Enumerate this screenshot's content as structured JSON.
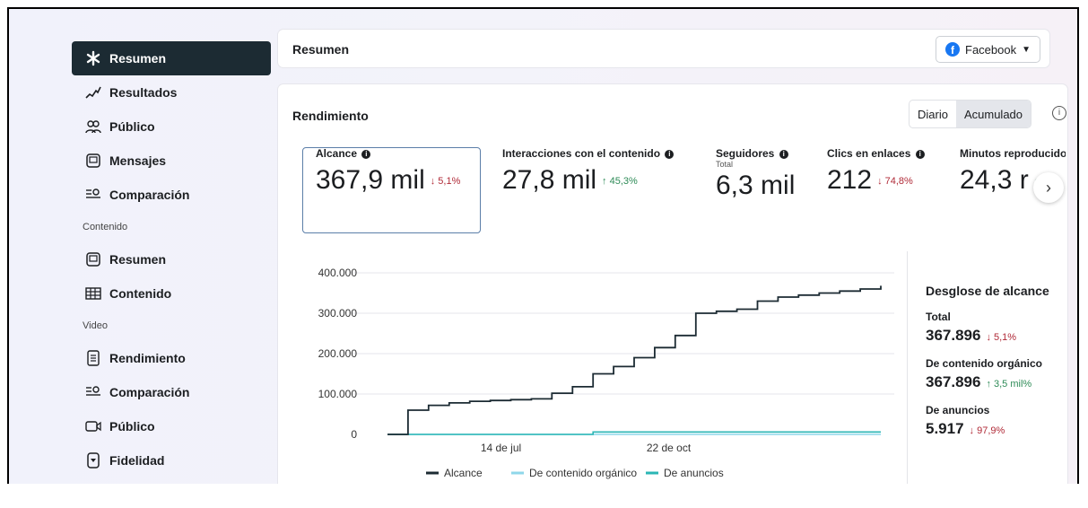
{
  "sidebar": {
    "items": [
      {
        "label": "Resumen",
        "icon": "asterisk-icon",
        "active": true
      },
      {
        "label": "Resultados",
        "icon": "trend-icon"
      },
      {
        "label": "Público",
        "icon": "people-icon"
      },
      {
        "label": "Mensajes",
        "icon": "inbox-icon"
      },
      {
        "label": "Comparación",
        "icon": "compare-icon"
      }
    ],
    "section_content": "Contenido",
    "content_items": [
      {
        "label": "Resumen",
        "icon": "inbox-icon"
      },
      {
        "label": "Contenido",
        "icon": "table-icon"
      }
    ],
    "section_video": "Video",
    "video_items": [
      {
        "label": "Rendimiento",
        "icon": "doc-icon"
      },
      {
        "label": "Comparación",
        "icon": "compare-icon"
      },
      {
        "label": "Público",
        "icon": "video-icon"
      },
      {
        "label": "Fidelidad",
        "icon": "shield-icon"
      }
    ]
  },
  "header": {
    "title": "Resumen",
    "platform": "Facebook"
  },
  "main": {
    "title": "Rendimiento",
    "toggle": [
      "Diario",
      "Acumulado"
    ],
    "metrics": [
      {
        "label": "Alcance",
        "value": "367,9 mil",
        "delta": "↓ 5,1%",
        "dir": "down"
      },
      {
        "label": "Interacciones con el contenido",
        "value": "27,8 mil",
        "delta": "↑ 45,3%",
        "dir": "up"
      },
      {
        "label": "Seguidores",
        "sub": "Total",
        "value": "6,3 mil"
      },
      {
        "label": "Clics en enlaces",
        "value": "212",
        "delta": "↓ 74,8%",
        "dir": "down"
      },
      {
        "label": "Minutos reproducido",
        "value": "24,3 r",
        "delta": "↑",
        "dir": "up"
      }
    ]
  },
  "breakdown": {
    "title": "Desglose de alcance",
    "rows": [
      {
        "label": "Total",
        "value": "367.896",
        "delta": "↓ 5,1%",
        "dir": "down"
      },
      {
        "label": "De contenido orgánico",
        "value": "367.896",
        "delta": "↑ 3,5 mil%",
        "dir": "up"
      },
      {
        "label": "De anuncios",
        "value": "5.917",
        "delta": "↓ 97,9%",
        "dir": "down"
      }
    ]
  },
  "chart_data": {
    "type": "line",
    "y_ticks": [
      "400.000",
      "300.000",
      "200.000",
      "100.000",
      "0"
    ],
    "ylim": [
      0,
      400000
    ],
    "x_tick_labels": [
      "14 de jul",
      "22 de oct"
    ],
    "colors": {
      "Alcance": "#1c2b33",
      "De contenido orgánico": "#8fd7ea",
      "De anuncios": "#2bb6b5"
    },
    "series": [
      {
        "name": "Alcance",
        "values": [
          0,
          60000,
          72000,
          78000,
          82000,
          84000,
          86000,
          88000,
          102000,
          118000,
          150000,
          168000,
          190000,
          215000,
          245000,
          300000,
          305000,
          310000,
          330000,
          340000,
          345000,
          350000,
          355000,
          360000,
          367896
        ]
      },
      {
        "name": "De contenido orgánico",
        "values": [
          0,
          0,
          0,
          0,
          0,
          0,
          0,
          0,
          0,
          0,
          0,
          0,
          0,
          0,
          0,
          0,
          0,
          0,
          0,
          0,
          0,
          0,
          0,
          0,
          0
        ]
      },
      {
        "name": "De anuncios",
        "values": [
          0,
          0,
          0,
          0,
          0,
          0,
          0,
          0,
          0,
          0,
          5900,
          5900,
          5900,
          5900,
          5900,
          5900,
          5900,
          5900,
          5900,
          5900,
          5900,
          5900,
          5900,
          5900,
          5917
        ]
      }
    ]
  }
}
